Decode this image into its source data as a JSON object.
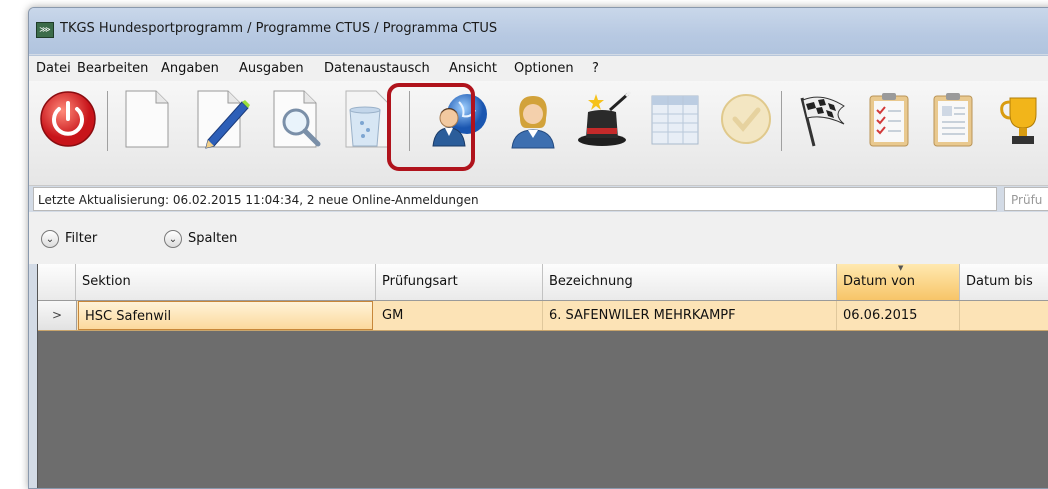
{
  "window": {
    "title": "TKGS Hundesportprogramm / Programme CTUS / Programma CTUS",
    "app_icon_glyph": "⋙"
  },
  "menu": {
    "items": [
      "Datei",
      "Bearbeiten",
      "Angaben",
      "Ausgaben",
      "Datenaustausch",
      "Ansicht",
      "Optionen",
      "?"
    ]
  },
  "toolbar": {
    "buttons": [
      {
        "icon": "power-icon"
      },
      {
        "icon": "new-document-icon"
      },
      {
        "icon": "edit-document-icon"
      },
      {
        "icon": "search-document-icon"
      },
      {
        "icon": "delete-document-icon"
      },
      {
        "icon": "online-users-globe-icon",
        "highlighted": true
      },
      {
        "icon": "user-woman-icon"
      },
      {
        "icon": "magic-hat-icon"
      },
      {
        "icon": "table-icon"
      },
      {
        "icon": "check-circle-icon"
      },
      {
        "icon": "checkered-flag-icon"
      },
      {
        "icon": "clipboard-checklist-icon"
      },
      {
        "icon": "clipboard-form-icon"
      },
      {
        "icon": "trophy-icon"
      }
    ],
    "highlight_color": "#b0131c"
  },
  "status": {
    "text": "Letzte Aktualisierung: 06.02.2015 11:04:34, 2 neue Online-Anmeldungen",
    "right_placeholder": "Prüfu"
  },
  "filterbar": {
    "filter_label": "Filter",
    "columns_label": "Spalten"
  },
  "grid": {
    "columns": [
      "Sektion",
      "Prüfungsart",
      "Bezeichnung",
      "Datum von",
      "Datum bis"
    ],
    "sorted_column": "Datum von",
    "rows": [
      {
        "indicator": ">",
        "cells": [
          "HSC Safenwil",
          "GM",
          "6. SAFENWILER MEHRKAMPF",
          "06.06.2015",
          ""
        ]
      }
    ],
    "row_color": "#fce3b6",
    "empty_area_color": "#6d6d6d"
  }
}
